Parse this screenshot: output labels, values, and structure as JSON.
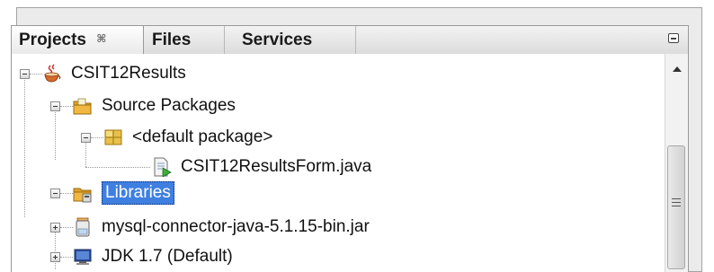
{
  "tabs": {
    "projects": "Projects",
    "files": "Files",
    "services": "Services"
  },
  "tree": {
    "project": "CSIT12Results",
    "source_packages": "Source Packages",
    "default_package": "<default package>",
    "form_file": "CSIT12ResultsForm.java",
    "libraries": "Libraries",
    "mysql_jar": "mysql-connector-java-5.1.15-bin.jar",
    "jdk": "JDK 1.7 (Default)"
  },
  "colors": {
    "selection": "#3f7fe0",
    "folder": "#e0a22a",
    "package": "#e8c04a"
  },
  "icons": {
    "project": "coffee-cup-icon",
    "source_packages": "source-folder-icon",
    "package": "package-icon",
    "java_file": "java-form-icon",
    "libraries": "library-folder-icon",
    "jar": "jar-icon",
    "jdk": "jdk-monitor-icon"
  }
}
